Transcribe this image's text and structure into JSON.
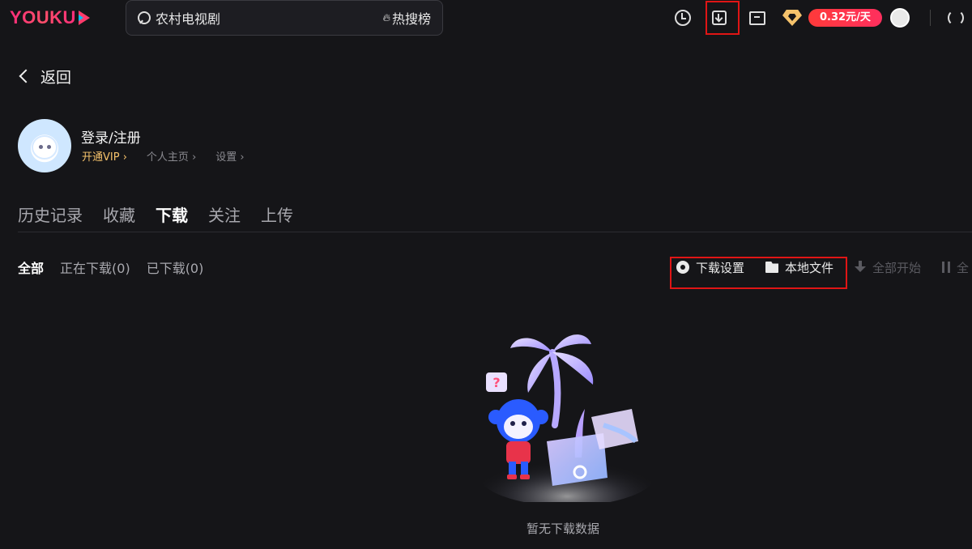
{
  "app": {
    "logo": "YOUKU"
  },
  "search": {
    "query": "农村电视剧",
    "hot_label": "热搜榜"
  },
  "topbar": {
    "vip_price": "0.32元/天",
    "icons": [
      "clock-icon",
      "download-icon",
      "folder-icon",
      "vip-gem-icon",
      "avatar",
      "refresh-icon"
    ]
  },
  "nav": {
    "back_label": "返回"
  },
  "profile": {
    "name": "登录/注册",
    "vip_link": "开通VIP",
    "home_link": "个人主页",
    "settings_link": "设置"
  },
  "tabs": [
    "历史记录",
    "收藏",
    "下载",
    "关注",
    "上传"
  ],
  "active_tab": "下载",
  "subtabs": [
    "全部",
    "正在下载(0)",
    "已下载(0)"
  ],
  "active_subtab": "全部",
  "actions": {
    "download_settings": "下载设置",
    "local_files": "本地文件",
    "start_all": "全部开始",
    "pause_all": "全"
  },
  "empty_state": {
    "message": "暂无下载数据"
  },
  "colors": {
    "background": "#151518",
    "accent_pink": "#ff3b6b",
    "vip_gold": "#f5c26b",
    "highlight_red": "#e01515"
  }
}
